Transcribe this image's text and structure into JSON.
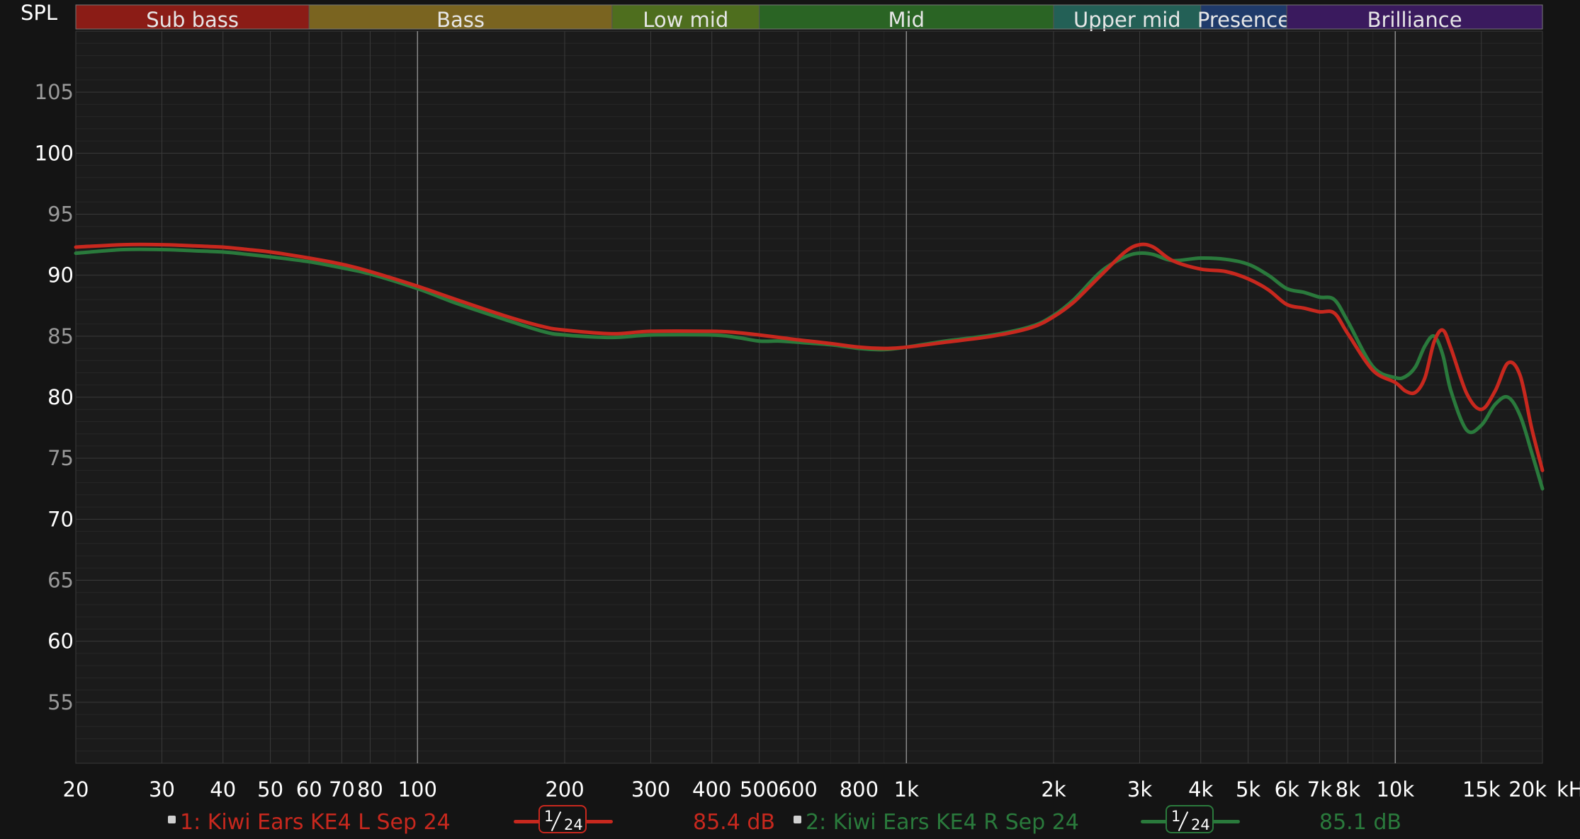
{
  "colors": {
    "series1": "#c8281e",
    "series2": "#2a7a3c",
    "background": "#141414",
    "plot_background": "#1b1b1b",
    "grid_major": "#3a3a3a",
    "grid_minor": "#262626"
  },
  "chart_data": {
    "type": "line",
    "ylabel": "SPL",
    "xlabel_unit": "kHz",
    "x_scale": "log",
    "xlim": [
      20,
      20000
    ],
    "ylim": [
      50,
      110
    ],
    "grid": true,
    "y_ticks": [
      55,
      60,
      65,
      70,
      75,
      80,
      85,
      90,
      95,
      100,
      105
    ],
    "x_ticks": [
      {
        "value": 20,
        "label": "20"
      },
      {
        "value": 30,
        "label": "30"
      },
      {
        "value": 40,
        "label": "40"
      },
      {
        "value": 50,
        "label": "50"
      },
      {
        "value": 60,
        "label": "60"
      },
      {
        "value": 70,
        "label": "70"
      },
      {
        "value": 80,
        "label": "80"
      },
      {
        "value": 100,
        "label": "100"
      },
      {
        "value": 200,
        "label": "200"
      },
      {
        "value": 300,
        "label": "300"
      },
      {
        "value": 400,
        "label": "400"
      },
      {
        "value": 500,
        "label": "500"
      },
      {
        "value": 600,
        "label": "600"
      },
      {
        "value": 800,
        "label": "800"
      },
      {
        "value": 1000,
        "label": "1k"
      },
      {
        "value": 2000,
        "label": "2k"
      },
      {
        "value": 3000,
        "label": "3k"
      },
      {
        "value": 4000,
        "label": "4k"
      },
      {
        "value": 5000,
        "label": "5k"
      },
      {
        "value": 6000,
        "label": "6k"
      },
      {
        "value": 7000,
        "label": "7k"
      },
      {
        "value": 8000,
        "label": "8k"
      },
      {
        "value": 10000,
        "label": "10k"
      },
      {
        "value": 15000,
        "label": "15k"
      },
      {
        "value": 20000,
        "label": "20k"
      }
    ],
    "bands": [
      {
        "name": "Sub bass",
        "from": 20,
        "to": 60,
        "color": "#8b1c16"
      },
      {
        "name": "Bass",
        "from": 60,
        "to": 250,
        "color": "#7a6420"
      },
      {
        "name": "Low mid",
        "from": 250,
        "to": 500,
        "color": "#4e6e1e"
      },
      {
        "name": "Mid",
        "from": 500,
        "to": 2000,
        "color": "#2a6424"
      },
      {
        "name": "Upper mid",
        "from": 2000,
        "to": 4000,
        "color": "#236056"
      },
      {
        "name": "Presence",
        "from": 4000,
        "to": 6000,
        "color": "#1f3a6a"
      },
      {
        "name": "Brilliance",
        "from": 6000,
        "to": 20000,
        "color": "#3a1a5e"
      }
    ],
    "series": [
      {
        "name": "1: Kiwi Ears KE4 L Sep 24",
        "x": [
          20,
          25,
          30,
          35,
          40,
          45,
          50,
          60,
          70,
          80,
          100,
          120,
          150,
          180,
          200,
          250,
          300,
          400,
          450,
          500,
          550,
          600,
          700,
          800,
          900,
          1000,
          1200,
          1500,
          1800,
          2000,
          2200,
          2500,
          2800,
          3000,
          3200,
          3500,
          4000,
          4500,
          5000,
          5500,
          6000,
          6500,
          7000,
          7500,
          8000,
          9000,
          10000,
          10500,
          11000,
          11500,
          12000,
          12500,
          13000,
          14000,
          15000,
          16000,
          17000,
          18000,
          19000,
          20000
        ],
        "y": [
          92.3,
          92.5,
          92.5,
          92.4,
          92.3,
          92.1,
          91.9,
          91.4,
          90.9,
          90.3,
          89.1,
          88.0,
          86.7,
          85.8,
          85.5,
          85.2,
          85.4,
          85.4,
          85.3,
          85.1,
          84.9,
          84.7,
          84.4,
          84.1,
          84.0,
          84.1,
          84.5,
          85.0,
          85.7,
          86.6,
          87.8,
          90.0,
          91.9,
          92.5,
          92.3,
          91.2,
          90.5,
          90.3,
          89.7,
          88.8,
          87.6,
          87.3,
          87.0,
          86.9,
          85.2,
          82.2,
          81.2,
          80.5,
          80.4,
          81.6,
          84.5,
          85.5,
          84.0,
          80.3,
          79.0,
          80.5,
          82.8,
          81.8,
          77.5,
          74.0
        ]
      },
      {
        "name": "2: Kiwi Ears KE4 R Sep 24",
        "x": [
          20,
          25,
          30,
          35,
          40,
          45,
          50,
          60,
          70,
          80,
          100,
          120,
          150,
          180,
          200,
          250,
          300,
          400,
          450,
          500,
          550,
          600,
          700,
          800,
          900,
          1000,
          1200,
          1500,
          1800,
          2000,
          2200,
          2500,
          2800,
          3000,
          3200,
          3500,
          4000,
          4500,
          5000,
          5500,
          6000,
          6500,
          7000,
          7500,
          8000,
          9000,
          10000,
          10500,
          11000,
          11500,
          12000,
          12500,
          13000,
          14000,
          15000,
          16000,
          17000,
          18000,
          19000,
          20000
        ],
        "y": [
          91.8,
          92.1,
          92.1,
          92.0,
          91.9,
          91.7,
          91.5,
          91.1,
          90.6,
          90.1,
          88.9,
          87.7,
          86.4,
          85.4,
          85.1,
          84.9,
          85.1,
          85.1,
          84.9,
          84.6,
          84.6,
          84.5,
          84.3,
          84.0,
          83.9,
          84.1,
          84.6,
          85.1,
          85.8,
          86.7,
          88.0,
          90.3,
          91.5,
          91.8,
          91.7,
          91.2,
          91.4,
          91.3,
          90.9,
          90.0,
          88.9,
          88.6,
          88.2,
          88.0,
          86.2,
          82.5,
          81.6,
          81.7,
          82.5,
          84.2,
          85.0,
          83.5,
          80.5,
          77.3,
          77.7,
          79.4,
          80.0,
          78.5,
          75.5,
          72.5
        ]
      }
    ]
  },
  "legend": {
    "entry1": {
      "label": "1: Kiwi Ears KE4 L Sep 24",
      "smoothing_num": "1",
      "smoothing_den": "24",
      "level": "85.4 dB"
    },
    "entry2": {
      "label": "2: Kiwi Ears KE4 R Sep 24",
      "smoothing_num": "1",
      "smoothing_den": "24",
      "level": "85.1 dB"
    }
  }
}
